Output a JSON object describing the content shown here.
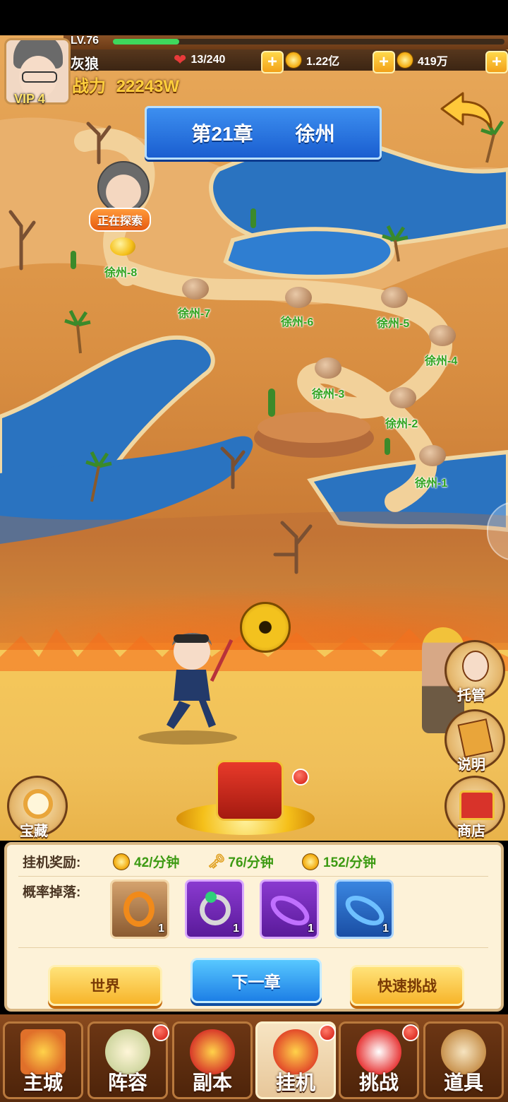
{
  "header": {
    "level": "LV.76",
    "player_name": "灰狼",
    "power_label": "战力",
    "power_value": "22243W",
    "vip": "VIP 4",
    "xp_progress": 0.17,
    "stamina": "13/240",
    "coins": "1.22亿",
    "gold": "419万"
  },
  "chapter": {
    "number": "第21章",
    "name": "徐州"
  },
  "map": {
    "exploring_label": "正在探索",
    "stages": [
      "徐州-8",
      "徐州-7",
      "徐州-6",
      "徐州-5",
      "徐州-4",
      "徐州-3",
      "徐州-2",
      "徐州-1"
    ]
  },
  "side_buttons": {
    "auto": "托管",
    "help": "说明",
    "treasure": "宝藏",
    "shop": "商店"
  },
  "rewards": {
    "idle_label": "挂机奖励:",
    "gold_rate": "42/分钟",
    "key_rate": "76/分钟",
    "coin_rate": "152/分钟",
    "drop_label": "概率掉落:",
    "items": [
      {
        "name": "dragon-ring",
        "count": "1",
        "color": "#b07a45"
      },
      {
        "name": "emerald-ring",
        "count": "1",
        "color": "#9b3fd0"
      },
      {
        "name": "purple-bracelet",
        "count": "1",
        "color": "#9b3fd0"
      },
      {
        "name": "blue-bracelet",
        "count": "1",
        "color": "#2f78d8"
      }
    ]
  },
  "actions": {
    "world": "世界",
    "next_chapter": "下一章",
    "quick_challenge": "快速挑战"
  },
  "nav": {
    "tabs": [
      "主城",
      "阵容",
      "副本",
      "挂机",
      "挑战",
      "道具"
    ],
    "active": "挂机"
  },
  "colors": {
    "stage_label": "#2fa31e",
    "reward_value": "#3c9a12",
    "power": "#ffcf3d"
  }
}
